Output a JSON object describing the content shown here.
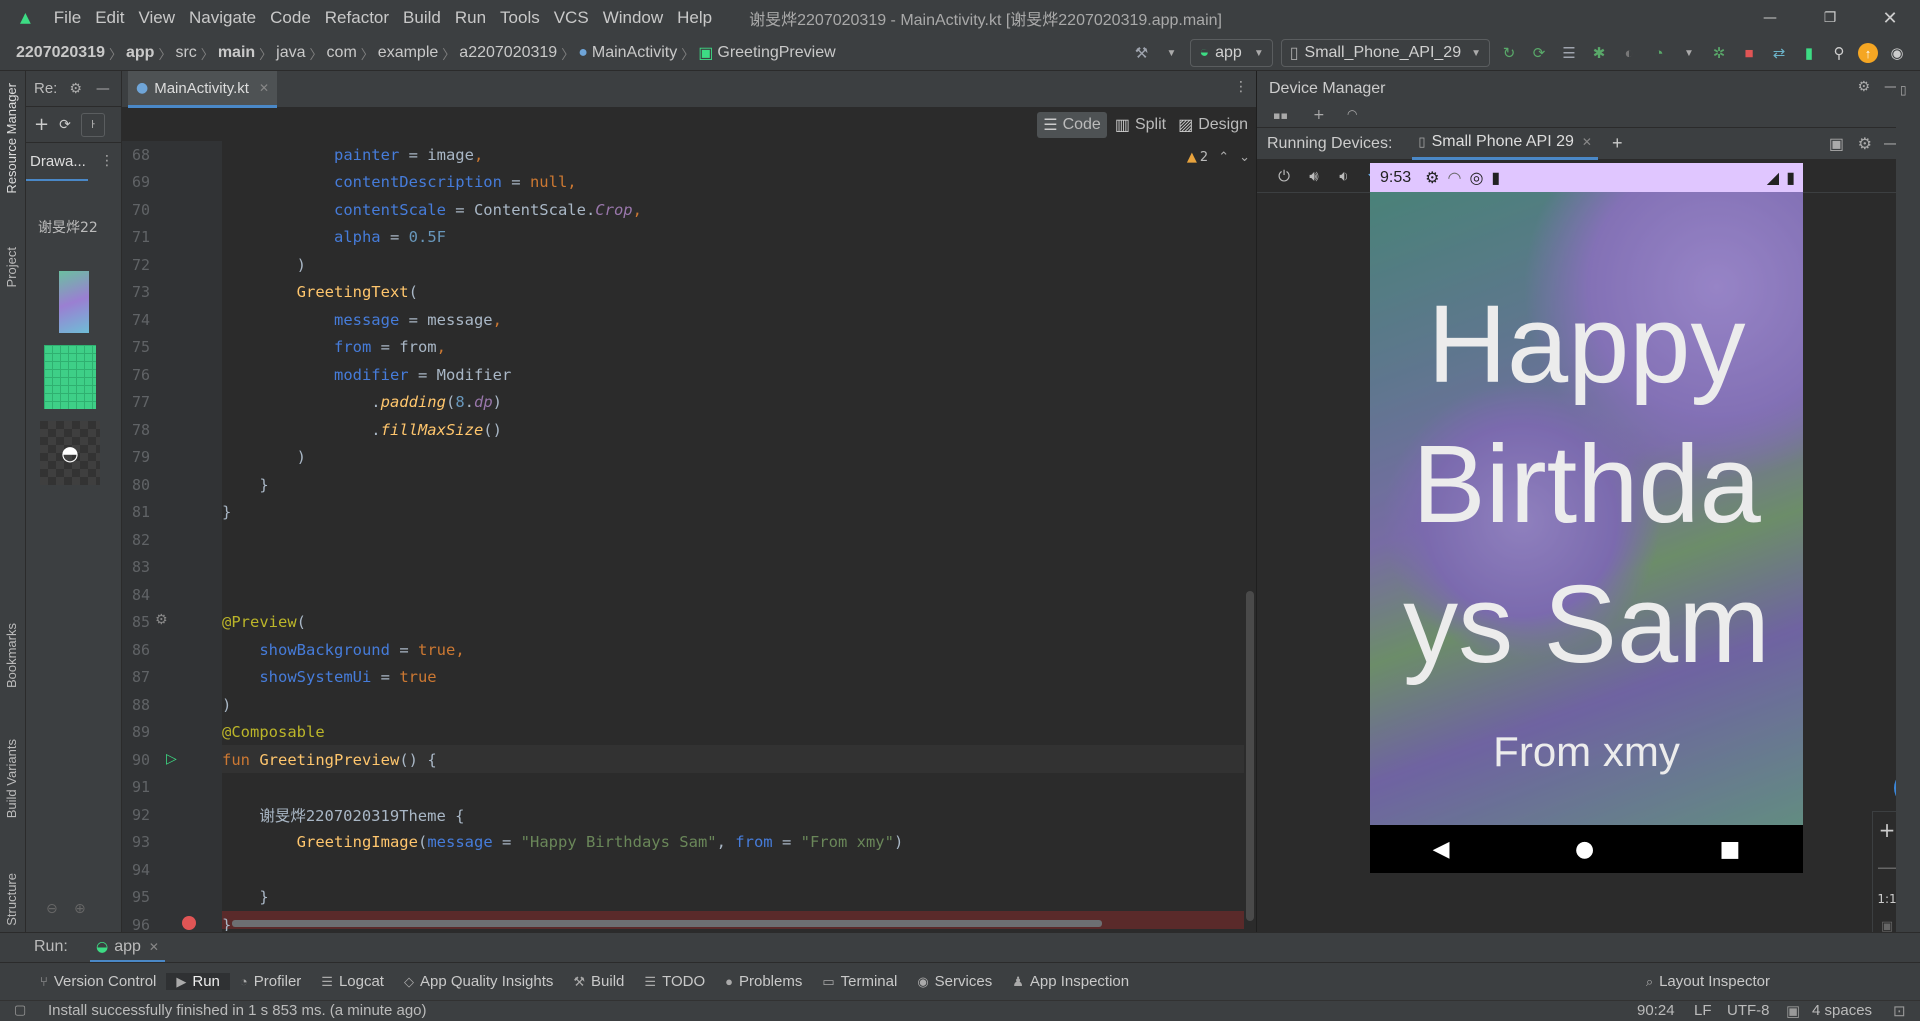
{
  "window": {
    "title": "谢旻烨2207020319 - MainActivity.kt [谢旻烨2207020319.app.main]",
    "menu": [
      "File",
      "Edit",
      "View",
      "Navigate",
      "Code",
      "Refactor",
      "Build",
      "Run",
      "Tools",
      "VCS",
      "Window",
      "Help"
    ]
  },
  "breadcrumb": [
    "2207020319",
    "app",
    "src",
    "main",
    "java",
    "com",
    "example",
    "a2207020319",
    "MainActivity",
    "GreetingPreview"
  ],
  "toolbar": {
    "run_config": "app",
    "device": "Small_Phone_API_29"
  },
  "left_strip": {
    "resource_manager": "Resource Manager",
    "project": "Project",
    "bookmarks": "Bookmarks",
    "build_variants": "Build Variants",
    "structure": "Structure"
  },
  "resources": {
    "panel_label": "Re:",
    "tab": "Drawa...",
    "module": "谢旻烨22"
  },
  "editor": {
    "tab": "MainActivity.kt",
    "view_code": "Code",
    "view_split": "Split",
    "view_design": "Design",
    "warnings": "2",
    "lines": [
      {
        "n": "68",
        "t": "            painter = image,"
      },
      {
        "n": "69",
        "t": "            contentDescription = null,"
      },
      {
        "n": "70",
        "t": "            contentScale = ContentScale.Crop,"
      },
      {
        "n": "71",
        "t": "            alpha = 0.5F"
      },
      {
        "n": "72",
        "t": "        )"
      },
      {
        "n": "73",
        "t": "        GreetingText("
      },
      {
        "n": "74",
        "t": "            message = message,"
      },
      {
        "n": "75",
        "t": "            from = from,"
      },
      {
        "n": "76",
        "t": "            modifier = Modifier"
      },
      {
        "n": "77",
        "t": "                .padding(8.dp)"
      },
      {
        "n": "78",
        "t": "                .fillMaxSize()"
      },
      {
        "n": "79",
        "t": "        )"
      },
      {
        "n": "80",
        "t": "    }"
      },
      {
        "n": "81",
        "t": "}"
      },
      {
        "n": "82",
        "t": ""
      },
      {
        "n": "83",
        "t": ""
      },
      {
        "n": "84",
        "t": ""
      },
      {
        "n": "85",
        "t": "@Preview("
      },
      {
        "n": "86",
        "t": "    showBackground = true,"
      },
      {
        "n": "87",
        "t": "    showSystemUi = true"
      },
      {
        "n": "88",
        "t": ")"
      },
      {
        "n": "89",
        "t": "@Composable"
      },
      {
        "n": "90",
        "t": "fun GreetingPreview() {"
      },
      {
        "n": "91",
        "t": ""
      },
      {
        "n": "92",
        "t": "    谢旻烨2207020319Theme {"
      },
      {
        "n": "93",
        "t": "        GreetingImage(message = \"Happy Birthdays Sam\", from = \"From xmy\")"
      },
      {
        "n": "94",
        "t": ""
      },
      {
        "n": "95",
        "t": "    }"
      },
      {
        "n": "96",
        "t": "}"
      }
    ]
  },
  "device_panel": {
    "title": "Device Manager",
    "running_label": "Running Devices:",
    "device_tab": "Small Phone API 29",
    "zoom_ratio": "1:1"
  },
  "phone": {
    "time": "9:53",
    "greeting_lines": [
      "Happy",
      "Birthda",
      "ys Sam"
    ],
    "from": "From xmy"
  },
  "run_bar": {
    "label": "Run:",
    "tab": "app"
  },
  "tool_windows": [
    "Version Control",
    "Run",
    "Profiler",
    "Logcat",
    "App Quality Insights",
    "Build",
    "TODO",
    "Problems",
    "Terminal",
    "Services",
    "App Inspection"
  ],
  "layout_inspector": "Layout Inspector",
  "status": {
    "message": "Install successfully finished in 1 s 853 ms. (a minute ago)",
    "position": "90:24",
    "line_sep": "LF",
    "encoding": "UTF-8",
    "indent": "4 spaces"
  }
}
